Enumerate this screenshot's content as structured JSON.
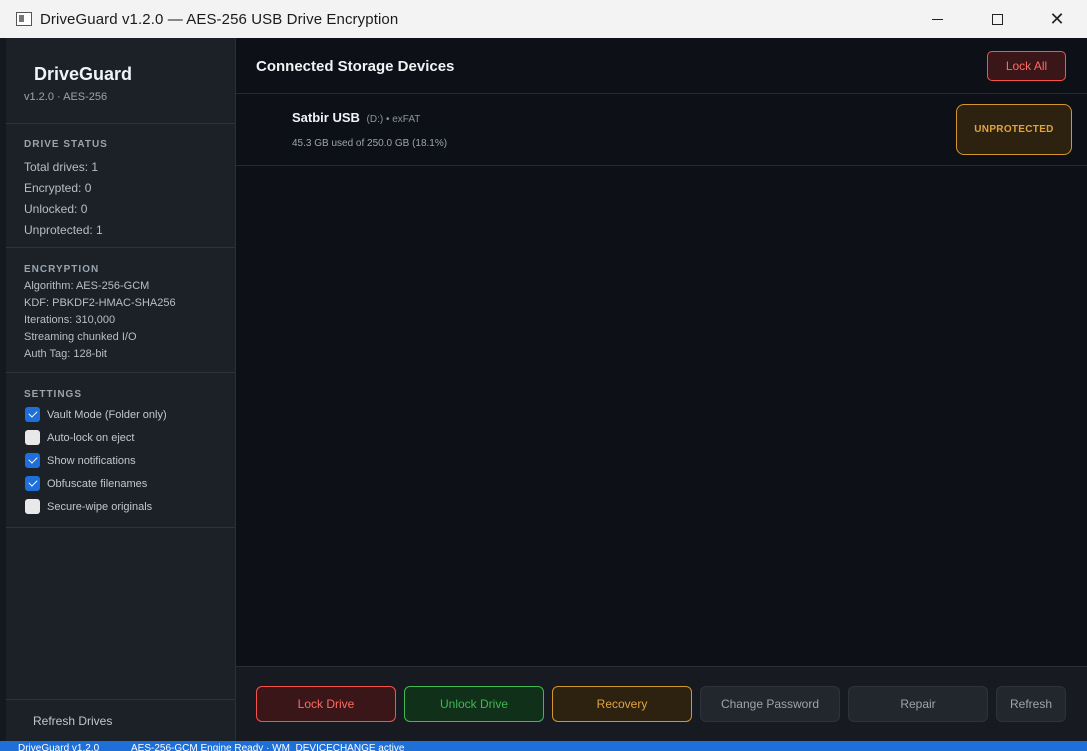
{
  "window": {
    "title": "DriveGuard v1.2.0  —  AES-256 USB Drive Encryption",
    "minimize_icon": "minimize-icon",
    "maximize_icon": "maximize-icon",
    "close_icon": "close-icon",
    "close_glyph": "✕"
  },
  "sidebar": {
    "brand": "DriveGuard",
    "version": "v1.2.0 · AES-256",
    "drive_status": {
      "title": "DRIVE STATUS",
      "items": [
        "Total drives:  1",
        "Encrypted:  0",
        "Unlocked:  0",
        "Unprotected:  1"
      ]
    },
    "encryption": {
      "title": "ENCRYPTION",
      "items": [
        "Algorithm: AES-256-GCM",
        "KDF: PBKDF2-HMAC-SHA256",
        "Iterations: 310,000",
        "Streaming chunked I/O",
        "Auth Tag: 128-bit"
      ]
    },
    "settings": {
      "title": "SETTINGS",
      "items": [
        {
          "label": "Vault Mode (Folder only)",
          "checked": true
        },
        {
          "label": "Auto-lock on eject",
          "checked": false
        },
        {
          "label": "Show notifications",
          "checked": true
        },
        {
          "label": "Obfuscate filenames",
          "checked": true
        },
        {
          "label": "Secure-wipe originals",
          "checked": false
        }
      ]
    },
    "refresh_label": "Refresh Drives"
  },
  "main": {
    "title": "Connected Storage Devices",
    "lock_all_label": "Lock All",
    "drives": [
      {
        "name": "Satbir USB",
        "meta": "(D:) • exFAT",
        "usage": "45.3 GB used of 250.0 GB  (18.1%)",
        "status": "UNPROTECTED"
      }
    ]
  },
  "actions": {
    "lock": "Lock Drive",
    "unlock": "Unlock Drive",
    "recovery": "Recovery",
    "change_password": "Change Password",
    "repair": "Repair",
    "refresh": "Refresh"
  },
  "statusbar": {
    "left": "DriveGuard v1.2.0",
    "right": "AES-256-GCM Engine Ready · WM_DEVICECHANGE active"
  },
  "colors": {
    "accent": "#1f6fd9",
    "danger": "#f85149",
    "success": "#3fb950",
    "warning": "#d4962a"
  }
}
